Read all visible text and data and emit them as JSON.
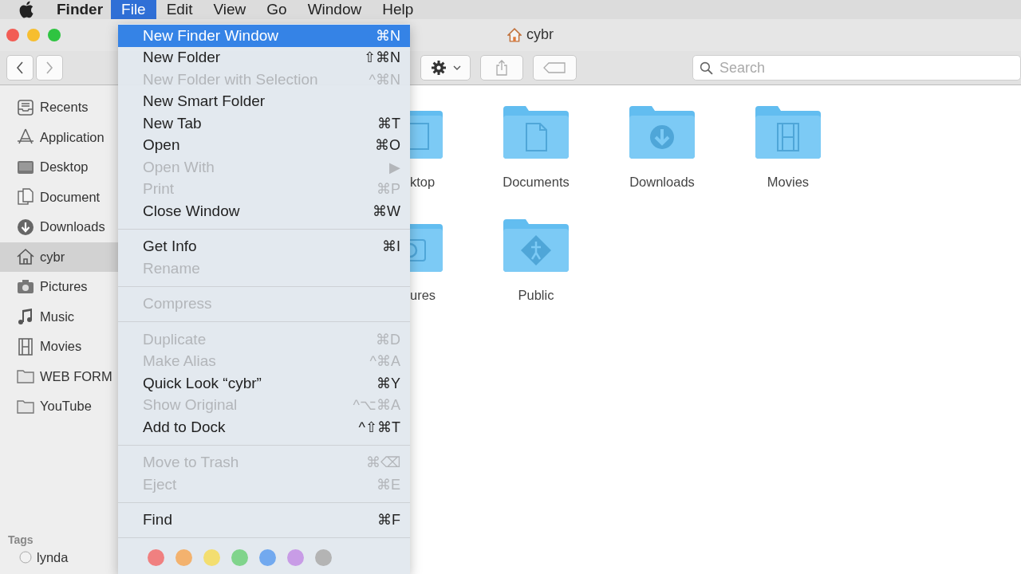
{
  "menubar": {
    "app": "Finder",
    "menus": [
      {
        "label": "File",
        "selected": true
      },
      {
        "label": "Edit",
        "selected": false
      },
      {
        "label": "View",
        "selected": false
      },
      {
        "label": "Go",
        "selected": false
      },
      {
        "label": "Window",
        "selected": false
      },
      {
        "label": "Help",
        "selected": false
      }
    ]
  },
  "window": {
    "title": "cybr"
  },
  "toolbar": {
    "search": {
      "placeholder": "Search"
    }
  },
  "sidebar": {
    "items": [
      {
        "kind": "recents",
        "label": "Recents",
        "selected": false
      },
      {
        "kind": "apps",
        "label": "Application",
        "selected": false
      },
      {
        "kind": "desktop",
        "label": "Desktop",
        "selected": false
      },
      {
        "kind": "documents",
        "label": "Document",
        "selected": false
      },
      {
        "kind": "downloads",
        "label": "Downloads",
        "selected": false
      },
      {
        "kind": "home",
        "label": "cybr",
        "selected": true
      },
      {
        "kind": "pictures",
        "label": "Pictures",
        "selected": false
      },
      {
        "kind": "music",
        "label": "Music",
        "selected": false
      },
      {
        "kind": "movies",
        "label": "Movies",
        "selected": false
      },
      {
        "kind": "folder",
        "label": "WEB FORM",
        "selected": false
      },
      {
        "kind": "folder",
        "label": "YouTube",
        "selected": false
      }
    ],
    "tags_heading": "Tags",
    "tags": [
      {
        "label": "lynda"
      }
    ]
  },
  "folders": [
    {
      "kind": "desktop",
      "label": "ktop",
      "cut": true
    },
    {
      "kind": "documents",
      "label": "Documents",
      "cut": false
    },
    {
      "kind": "downloads",
      "label": "Downloads",
      "cut": false
    },
    {
      "kind": "movies",
      "label": "Movies",
      "cut": false
    },
    {
      "kind": "pictures",
      "label": "ures",
      "cut": true
    },
    {
      "kind": "public",
      "label": "Public",
      "cut": false
    }
  ],
  "file_menu": [
    {
      "kind": "item",
      "label": "New Finder Window",
      "shortcut": "⌘N",
      "disabled": false,
      "selected": true
    },
    {
      "kind": "item",
      "label": "New Folder",
      "shortcut": "⇧⌘N",
      "disabled": false,
      "selected": false
    },
    {
      "kind": "item",
      "label": "New Folder with Selection",
      "shortcut": "^⌘N",
      "disabled": true,
      "selected": false
    },
    {
      "kind": "item",
      "label": "New Smart Folder",
      "disabled": false,
      "selected": false
    },
    {
      "kind": "item",
      "label": "New Tab",
      "shortcut": "⌘T",
      "disabled": false,
      "selected": false
    },
    {
      "kind": "item",
      "label": "Open",
      "shortcut": "⌘O",
      "disabled": false,
      "selected": false
    },
    {
      "kind": "item",
      "label": "Open With",
      "shortcut": "▶",
      "disabled": true,
      "selected": false
    },
    {
      "kind": "item",
      "label": "Print",
      "shortcut": "⌘P",
      "disabled": true,
      "selected": false
    },
    {
      "kind": "item",
      "label": "Close Window",
      "shortcut": "⌘W",
      "disabled": false,
      "selected": false
    },
    {
      "kind": "separator"
    },
    {
      "kind": "item",
      "label": "Get Info",
      "shortcut": "⌘I",
      "disabled": false,
      "selected": false
    },
    {
      "kind": "item",
      "label": "Rename",
      "disabled": true,
      "selected": false
    },
    {
      "kind": "separator"
    },
    {
      "kind": "item",
      "label": "Compress",
      "disabled": true,
      "selected": false
    },
    {
      "kind": "separator"
    },
    {
      "kind": "item",
      "label": "Duplicate",
      "shortcut": "⌘D",
      "disabled": true,
      "selected": false
    },
    {
      "kind": "item",
      "label": "Make Alias",
      "shortcut": "^⌘A",
      "disabled": true,
      "selected": false
    },
    {
      "kind": "item",
      "label": "Quick Look “cybr”",
      "shortcut": "⌘Y",
      "disabled": false,
      "selected": false
    },
    {
      "kind": "item",
      "label": "Show Original",
      "shortcut": "^⌥⌘A",
      "disabled": true,
      "selected": false
    },
    {
      "kind": "item",
      "label": "Add to Dock",
      "shortcut": "^⇧⌘T",
      "disabled": false,
      "selected": false
    },
    {
      "kind": "separator"
    },
    {
      "kind": "item",
      "label": "Move to Trash",
      "shortcut": "⌘⌫",
      "disabled": true,
      "selected": false
    },
    {
      "kind": "item",
      "label": "Eject",
      "shortcut": "⌘E",
      "disabled": true,
      "selected": false
    },
    {
      "kind": "separator"
    },
    {
      "kind": "item",
      "label": "Find",
      "shortcut": "⌘F",
      "disabled": false,
      "selected": false
    },
    {
      "kind": "separator"
    },
    {
      "kind": "tags",
      "colors": [
        {
          "color": "#f08080"
        },
        {
          "color": "#f3b26e"
        },
        {
          "color": "#f3de70"
        },
        {
          "color": "#80d48c"
        },
        {
          "color": "#72a9ef"
        },
        {
          "color": "#c89ce6"
        },
        {
          "color": "#b4b4b4"
        }
      ]
    }
  ]
}
